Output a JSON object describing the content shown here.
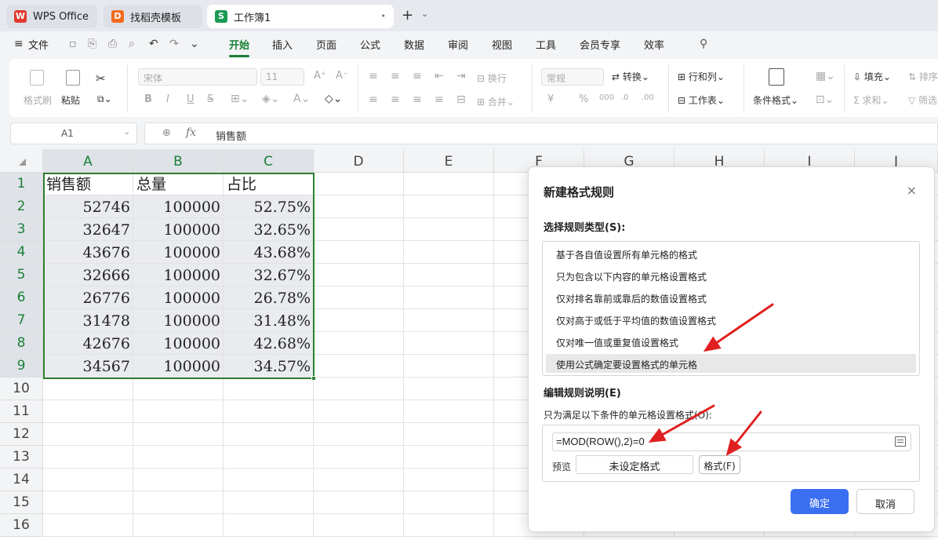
{
  "titlebar": {
    "tabs": [
      {
        "label": "WPS Office",
        "state": "inactive"
      },
      {
        "label": "找稻壳模板",
        "state": "inactive"
      },
      {
        "label": "工作簿1",
        "state": "active"
      }
    ],
    "new_tab_label": "+",
    "new_tab_dropdown": "⌄",
    "close_tab": "•"
  },
  "menubar": {
    "file_label": "文件",
    "menus": [
      "开始",
      "插入",
      "页面",
      "公式",
      "数据",
      "审阅",
      "视图",
      "工具",
      "会员专享",
      "效率"
    ],
    "active_menu": "开始"
  },
  "ribbon": {
    "format_painter": "格式刷",
    "paste": "粘贴",
    "font_name": "宋体",
    "font_size": "11",
    "wrap": "换行",
    "merge": "合并",
    "number_format": "常规",
    "convert": "转换",
    "row_col": "行和列",
    "worksheet": "工作表",
    "cond_format": "条件格式",
    "fill": "填充",
    "sum": "求和",
    "sort": "排序",
    "filter": "筛选",
    "bold": "B",
    "italic": "I",
    "underline": "U",
    "currency": "¥",
    "percent": "%"
  },
  "formula_bar": {
    "cell_ref": "A1",
    "fx_label": "fx",
    "value": "销售额"
  },
  "sheet": {
    "columns": [
      "A",
      "B",
      "C",
      "D",
      "E",
      "F",
      "G",
      "H",
      "I",
      "J"
    ],
    "rows": [
      "1",
      "2",
      "3",
      "4",
      "5",
      "6",
      "7",
      "8",
      "9",
      "10",
      "11",
      "12",
      "13",
      "14",
      "15",
      "16"
    ],
    "data": [
      [
        "销售额",
        "总量",
        "占比"
      ],
      [
        "52746",
        "100000",
        "52.75%"
      ],
      [
        "32647",
        "100000",
        "32.65%"
      ],
      [
        "43676",
        "100000",
        "43.68%"
      ],
      [
        "32666",
        "100000",
        "32.67%"
      ],
      [
        "26776",
        "100000",
        "26.78%"
      ],
      [
        "31478",
        "100000",
        "31.48%"
      ],
      [
        "42676",
        "100000",
        "42.68%"
      ],
      [
        "34567",
        "100000",
        "34.57%"
      ]
    ]
  },
  "dialog": {
    "title": "新建格式规则",
    "close": "×",
    "select_type_label": "选择规则类型(S):",
    "rule_types": [
      "基于各自值设置所有单元格的格式",
      "只为包含以下内容的单元格设置格式",
      "仅对排名靠前或靠后的数值设置格式",
      "仅对高于或低于平均值的数值设置格式",
      "仅对唯一值或重复值设置格式",
      "使用公式确定要设置格式的单元格"
    ],
    "selected_rule_index": 5,
    "edit_label": "编辑规则说明(E)",
    "condition_label": "只为满足以下条件的单元格设置格式(O):",
    "formula": "=MOD(ROW(),2)=0",
    "preview_label": "预览",
    "preview_value": "未设定格式",
    "format_button": "格式(F)",
    "ok_button": "确定",
    "cancel_button": "取消"
  },
  "colors": {
    "accent": "#1a7f37",
    "selection_border": "#2f7d32",
    "primary_button": "#3b6ff2",
    "annotation_arrow": "#e02020"
  }
}
